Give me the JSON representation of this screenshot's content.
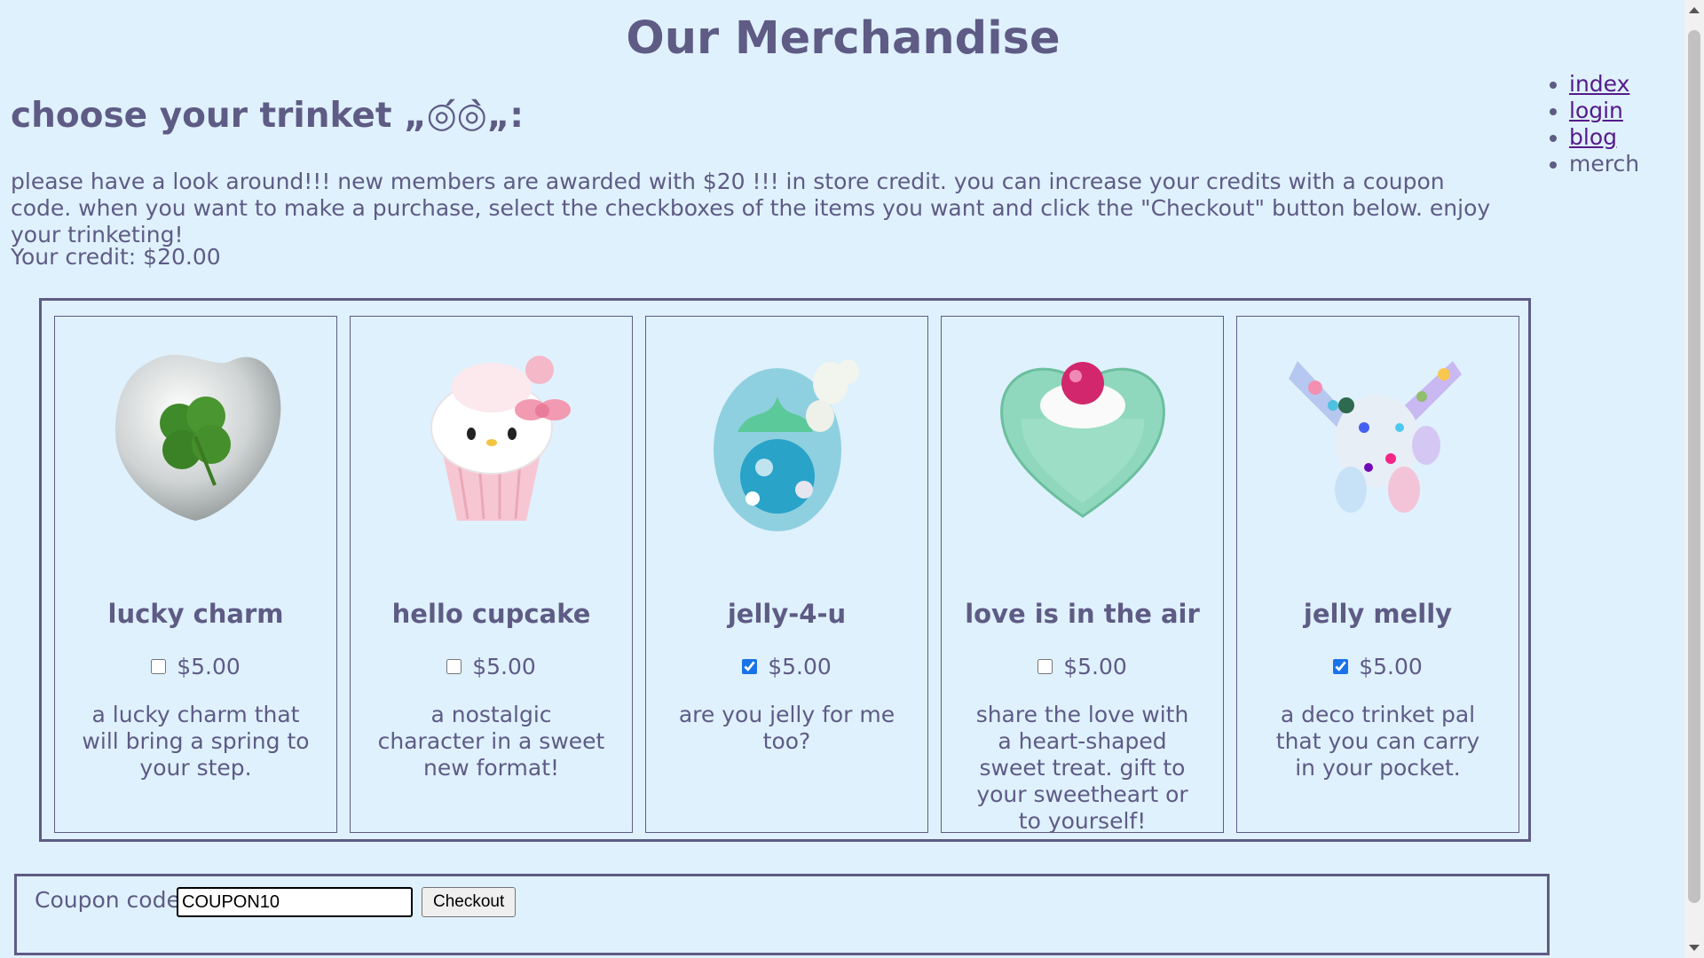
{
  "header": {
    "title": "Our Merchandise",
    "subtitle": "choose your trinket „◎́◎̀„:",
    "intro": "please have a look around!!! new members are awarded with $20 !!! in store credit. you can increase your credits with a coupon code. when you want to make a purchase, select the checkboxes of the items you want and click the \"Checkout\" button below. enjoy your trinketing!",
    "credit_label": "Your credit:",
    "credit_value": "$20.00"
  },
  "nav": {
    "items": [
      {
        "label": "index",
        "link": true
      },
      {
        "label": "login",
        "link": true
      },
      {
        "label": "blog",
        "link": true
      },
      {
        "label": "merch",
        "link": false
      }
    ]
  },
  "products": [
    {
      "name": "lucky charm",
      "price": "$5.00",
      "checked": false,
      "description": "a lucky charm that will bring a spring to your step.",
      "image": "clover-heart-charm"
    },
    {
      "name": "hello cupcake",
      "price": "$5.00",
      "checked": false,
      "description": "a nostalgic character in a sweet new format!",
      "image": "kitty-cupcake-charm"
    },
    {
      "name": "jelly-4-u",
      "price": "$5.00",
      "checked": true,
      "description": "are you jelly for me too?",
      "image": "jelly-egg-charm"
    },
    {
      "name": "love is in the air",
      "price": "$5.00",
      "checked": false,
      "description": "share the love with a heart-shaped sweet treat. gift to your sweetheart or to yourself!",
      "image": "heart-cake-charm"
    },
    {
      "name": "jelly melly",
      "price": "$5.00",
      "checked": true,
      "description": "a deco trinket pal that you can carry in your pocket.",
      "image": "deco-bunny-charm"
    }
  ],
  "coupon": {
    "label": "Coupon code:",
    "value": "COUPON10",
    "checkout_label": "Checkout"
  },
  "colors": {
    "background": "#dff1fd",
    "text": "#5e5b85",
    "visited_link": "#551a8b"
  }
}
